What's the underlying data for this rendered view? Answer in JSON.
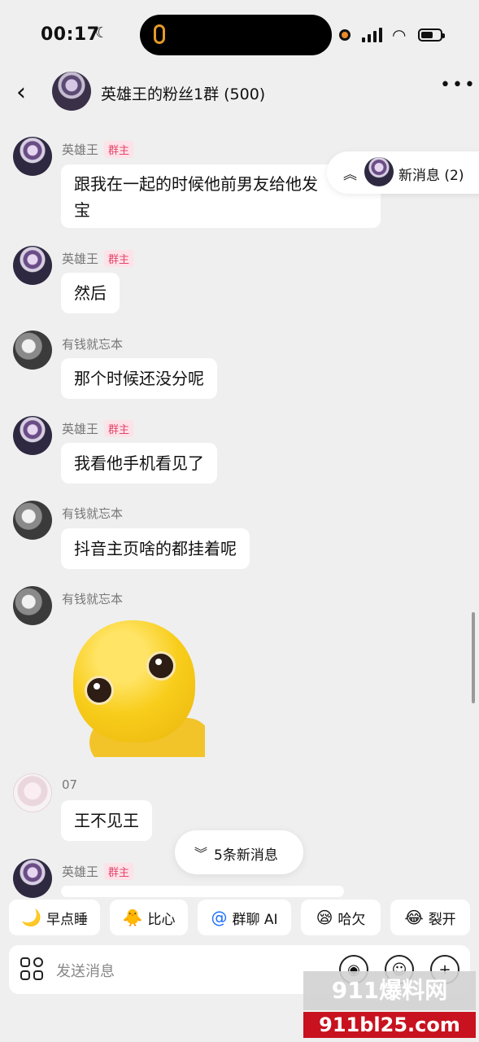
{
  "status": {
    "time": "00:17"
  },
  "header": {
    "title": "英雄王的粉丝1群 (500)"
  },
  "messages": [
    {
      "name": "英雄王",
      "badge": "群主",
      "text": "跟我在一起的时候他前男友给他发",
      "text2": "宝"
    },
    {
      "name": "英雄王",
      "badge": "群主",
      "text": "然后"
    },
    {
      "name": "有钱就忘本",
      "text": "那个时候还没分呢"
    },
    {
      "name": "英雄王",
      "badge": "群主",
      "text": "我看他手机看见了"
    },
    {
      "name": "有钱就忘本",
      "text": "抖音主页啥的都挂着呢"
    },
    {
      "name": "有钱就忘本",
      "sticker": "yellow-dino-sticker"
    },
    {
      "name": "07",
      "text": "王不见王"
    },
    {
      "name": "英雄王",
      "badge": "群主"
    }
  ],
  "new_top": {
    "label": "新消息 (2)"
  },
  "new_bottom": {
    "label": "5条新消息"
  },
  "chips": [
    {
      "emoji": "🌙",
      "label": "早点睡"
    },
    {
      "emoji": "🐥",
      "label": "比心"
    },
    {
      "emoji": "@",
      "label": "群聊 AI"
    },
    {
      "emoji": "😪",
      "label": "哈欠"
    },
    {
      "emoji": "😂",
      "label": "裂开"
    }
  ],
  "input": {
    "placeholder": "发送消息"
  },
  "watermark": {
    "top": "911爆料网",
    "bottom": "911bl25.com"
  }
}
